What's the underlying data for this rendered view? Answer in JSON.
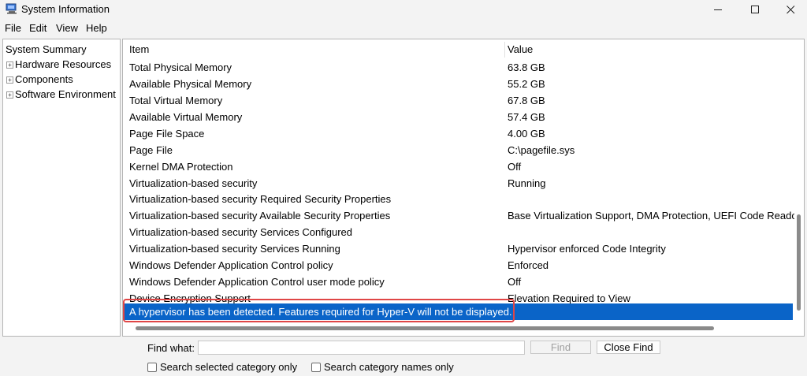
{
  "window": {
    "title": "System Information",
    "controls": {
      "minimize": "—",
      "maximize": "☐",
      "close": "✕"
    }
  },
  "menu": [
    "File",
    "Edit",
    "View",
    "Help"
  ],
  "tree": {
    "root": "System Summary",
    "children": [
      "Hardware Resources",
      "Components",
      "Software Environment"
    ]
  },
  "list": {
    "headers": {
      "item": "Item",
      "value": "Value"
    },
    "rows": [
      {
        "item": "Total Physical Memory",
        "value": "63.8 GB"
      },
      {
        "item": "Available Physical Memory",
        "value": "55.2 GB"
      },
      {
        "item": "Total Virtual Memory",
        "value": "67.8 GB"
      },
      {
        "item": "Available Virtual Memory",
        "value": "57.4 GB"
      },
      {
        "item": "Page File Space",
        "value": "4.00 GB"
      },
      {
        "item": "Page File",
        "value": "C:\\pagefile.sys"
      },
      {
        "item": "Kernel DMA Protection",
        "value": "Off"
      },
      {
        "item": "Virtualization-based security",
        "value": "Running"
      },
      {
        "item": "Virtualization-based security Required Security Properties",
        "value": ""
      },
      {
        "item": "Virtualization-based security Available Security Properties",
        "value": "Base Virtualization Support, DMA Protection, UEFI Code Readon"
      },
      {
        "item": "Virtualization-based security Services Configured",
        "value": ""
      },
      {
        "item": "Virtualization-based security Services Running",
        "value": "Hypervisor enforced Code Integrity"
      },
      {
        "item": "Windows Defender Application Control policy",
        "value": "Enforced"
      },
      {
        "item": "Windows Defender Application Control user mode policy",
        "value": "Off"
      },
      {
        "item": "Device Encryption Support",
        "value": "Elevation Required to View"
      },
      {
        "item": "A hypervisor has been detected. Features required for Hyper-V will not be displayed.",
        "value": ""
      }
    ]
  },
  "find": {
    "label": "Find what:",
    "value": "",
    "find_button": "Find",
    "close_button": "Close Find",
    "check_selected_category": "Search selected category only",
    "check_category_names": "Search category names only"
  },
  "colors": {
    "selection": "#0a64c8",
    "highlight_border": "#e04646"
  }
}
